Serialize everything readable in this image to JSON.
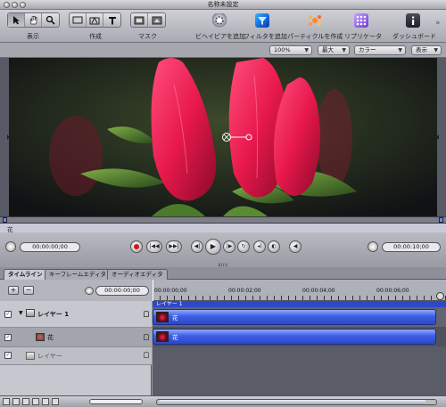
{
  "window": {
    "title": "名称未設定"
  },
  "toolbar": {
    "groups": [
      {
        "label": "表示"
      },
      {
        "label": "作成"
      },
      {
        "label": "マスク"
      }
    ],
    "actions": [
      {
        "label": "ビヘイビアを追加"
      },
      {
        "label": "フィルタを追加"
      },
      {
        "label": "パーティクルを作成"
      },
      {
        "label": "リプリケータ"
      },
      {
        "label": "ダッシュボード"
      }
    ]
  },
  "options": {
    "zoom": "100%",
    "quality": "最大",
    "channel": "カラー",
    "view": "表示"
  },
  "canvas": {
    "image_subject": "red flower buds"
  },
  "minitimeline": {
    "label": "花"
  },
  "transport": {
    "current_time": "00:00:00;00",
    "duration": "00:00:10;00"
  },
  "tabs": [
    {
      "label": "タイムライン"
    },
    {
      "label": "キーフレームエディタ"
    },
    {
      "label": "オーディオエディタ"
    }
  ],
  "timeline": {
    "time_field": "00:00:00;00",
    "ruler_ticks": [
      "00:00:00;00",
      "00:00:02;00",
      "00:00:04;00",
      "00:00:06;00"
    ],
    "group_label": "レイヤー 1",
    "layers": [
      {
        "name": "レイヤー 1"
      },
      {
        "name": "花"
      },
      {
        "name": "レイヤー"
      }
    ],
    "clips": [
      {
        "label": "花"
      },
      {
        "label": "花"
      }
    ]
  },
  "colors": {
    "accent": "#3c5ee4",
    "track_bg": "#5a5c68"
  }
}
